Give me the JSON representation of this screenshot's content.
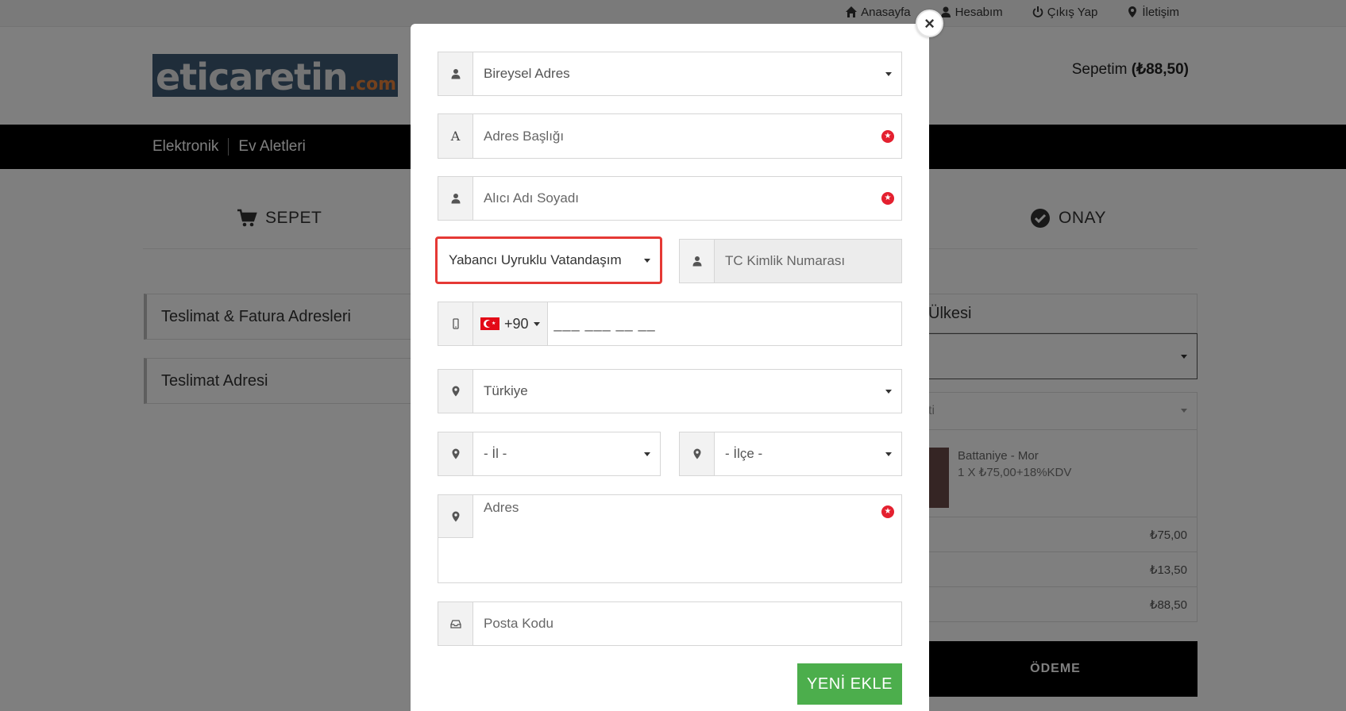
{
  "topbar": {
    "links": [
      {
        "icon": "home-icon",
        "label": "Anasayfa"
      },
      {
        "icon": "user-icon",
        "label": "Hesabım"
      },
      {
        "icon": "power-icon",
        "label": "Çıkış Yap"
      },
      {
        "icon": "map-marker-icon",
        "label": "İletişim"
      }
    ]
  },
  "header": {
    "logo_text": "eticaretin",
    "logo_suffix": ".com",
    "cart_label": "Sepetim",
    "cart_total": "(₺88,50)"
  },
  "nav": {
    "items": [
      "Elektronik",
      "Ev Aletleri"
    ]
  },
  "steps": {
    "cart": "SEPET",
    "confirm": "ONAY"
  },
  "left": {
    "box1": "Teslimat & Fatura Adresleri",
    "box2": "Teslimat Adresi"
  },
  "right": {
    "title": "Ülkesi",
    "select2": "ti",
    "product_name": "Battaniye - Mor",
    "product_price": "1 X ₺75,00+18%KDV",
    "subtotal": "₺75,00",
    "tax": "₺13,50",
    "total": "₺88,50",
    "pay_button": "ÖDEME"
  },
  "modal": {
    "close_symbol": "×",
    "address_type": "Bireysel Adres",
    "address_title_placeholder": "Adres Başlığı",
    "recipient_placeholder": "Alıcı Adı Soyadı",
    "citizenship": "Yabancı Uyruklu Vatandaşım",
    "tc_placeholder": "TC Kimlik Numarası",
    "dial_code": "+90",
    "phone_mask": "___ ___ __ __",
    "country": "Türkiye",
    "province": "- İl -",
    "district": "- İlçe -",
    "address_placeholder": "Adres",
    "postal_placeholder": "Posta Kodu",
    "submit_label": "YENİ EKLE",
    "required_symbol": "★"
  },
  "colors": {
    "accent_green": "#4cae4c",
    "highlight_red": "#e53935",
    "required_red": "#e4202f",
    "navbar": "#000000"
  }
}
